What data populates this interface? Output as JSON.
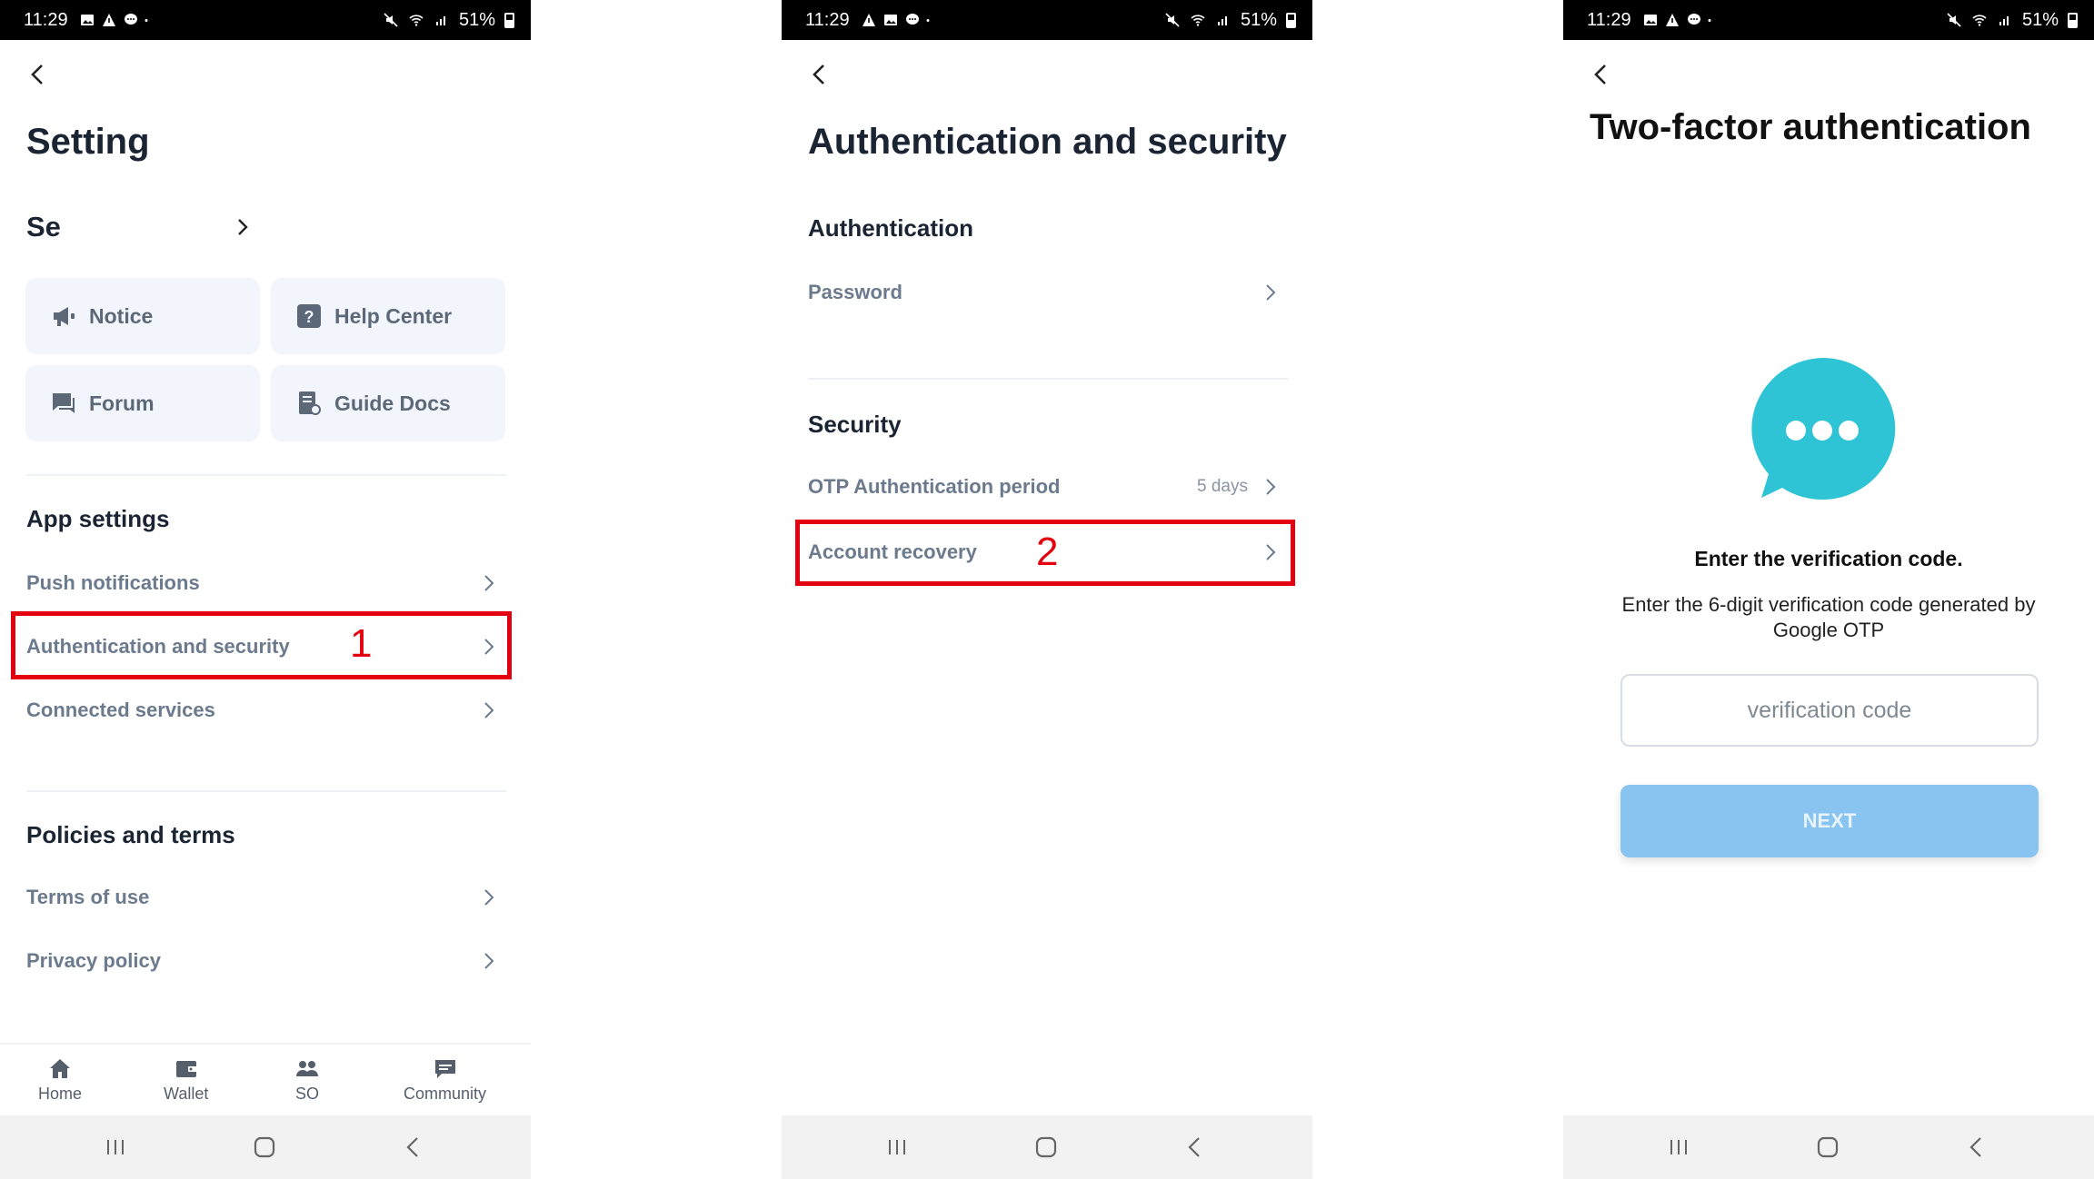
{
  "status_bar": {
    "time": "11:29",
    "battery": "51%"
  },
  "screen1": {
    "title": "Setting",
    "se_label": "Se",
    "tiles": [
      {
        "label": "Notice",
        "icon": "megaphone-icon"
      },
      {
        "label": "Help Center",
        "icon": "question-icon"
      },
      {
        "label": "Forum",
        "icon": "chat-icon"
      },
      {
        "label": "Guide Docs",
        "icon": "document-icon"
      }
    ],
    "app_settings": {
      "title": "App settings",
      "items": [
        "Push notifications",
        "Authentication and security",
        "Connected services"
      ]
    },
    "policies": {
      "title": "Policies and terms",
      "items": [
        "Terms of use",
        "Privacy policy"
      ]
    },
    "annotation": "1",
    "bottom_nav": [
      "Home",
      "Wallet",
      "SO",
      "Community"
    ]
  },
  "screen2": {
    "title": "Authentication and security",
    "authentication": {
      "title": "Authentication",
      "items": [
        "Password"
      ]
    },
    "security": {
      "title": "Security",
      "otp_label": "OTP Authentication period",
      "otp_value": "5 days",
      "recovery_label": "Account recovery"
    },
    "annotation": "2"
  },
  "screen3": {
    "title": "Two-factor authentication",
    "verify_title": "Enter the verification code.",
    "verify_desc": "Enter the 6-digit verification code generated by Google OTP",
    "input_placeholder": "verification code",
    "next_label": "NEXT"
  },
  "colors": {
    "accent_blue": "#89c3ef",
    "bubble": "#2ec4d6",
    "annotation_red": "#e3000f",
    "tile_bg": "#f2f6fc"
  }
}
